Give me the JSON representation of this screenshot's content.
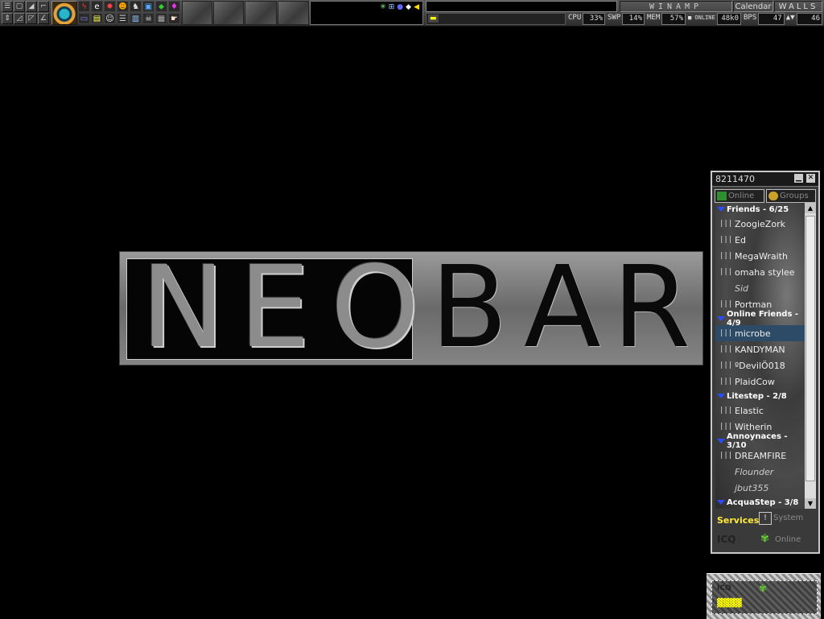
{
  "topbar": {
    "tools": [
      "☰",
      "▢",
      "◢",
      "⌐",
      "⇕",
      "◿",
      "◸",
      "∠"
    ],
    "apps": [
      "ϟ",
      "e",
      "✹",
      "☻",
      "♞",
      "▣",
      "⬥",
      "♦",
      "▭",
      "▤",
      "☺",
      "☰",
      "▥",
      "☠",
      "▦",
      "☛"
    ],
    "winamp": "WINAMP",
    "calendar": "Calendar",
    "walls": "WALLS",
    "meters": {
      "cpu_label": "CPU",
      "cpu": "33%",
      "swp_label": "SWP",
      "swp": "14%",
      "mem_label": "MEM",
      "mem": "57%",
      "online_label": "■ ONLINE",
      "online": "48k0",
      "bps_label": "BPS",
      "bps_a": "47",
      "bps_b": "46"
    }
  },
  "logo": {
    "letters": [
      "N",
      "E",
      "O",
      "B",
      "A",
      "R"
    ]
  },
  "icq": {
    "uin": "8211470",
    "tab_online": "Online",
    "tab_groups": "Groups",
    "groups": [
      {
        "title": "Friends - 6/25",
        "users": [
          {
            "name": "ZoogieZork",
            "status": "online"
          },
          {
            "name": "Ed",
            "status": "online"
          },
          {
            "name": "MegaWraith",
            "status": "online"
          },
          {
            "name": "omaha stylee",
            "status": "online"
          },
          {
            "name": "Sid",
            "status": "offline"
          },
          {
            "name": "Portman",
            "status": "online"
          }
        ]
      },
      {
        "title": "Online Friends - 4/9",
        "users": [
          {
            "name": "microbe",
            "status": "online",
            "selected": true
          },
          {
            "name": "KANDYMAN",
            "status": "online"
          },
          {
            "name": "ºDevilÖ018",
            "status": "online"
          },
          {
            "name": "PlaidCow",
            "status": "online"
          }
        ]
      },
      {
        "title": "Litestep - 2/8",
        "users": [
          {
            "name": "Elastic",
            "status": "online"
          },
          {
            "name": "Witherin",
            "status": "online"
          }
        ]
      },
      {
        "title": "Annoynaces - 3/10",
        "users": [
          {
            "name": "DREAMFIRE",
            "status": "online"
          },
          {
            "name": "Flounder",
            "status": "offline"
          },
          {
            "name": "jbut355",
            "status": "offline"
          }
        ]
      },
      {
        "title": "AcquaStep - 3/8",
        "users": []
      }
    ],
    "services": "Services",
    "system": "System",
    "status": "Online"
  },
  "colors": {
    "accent": "#2b4cff",
    "selected": "#2d4a66",
    "services": "#ffeb3b"
  }
}
